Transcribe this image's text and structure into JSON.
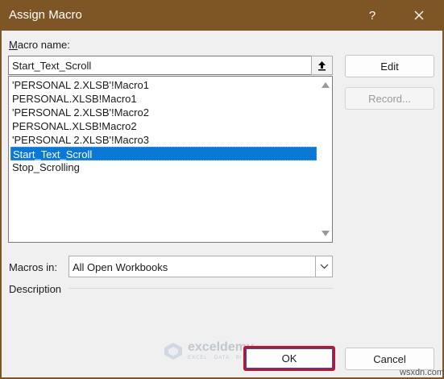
{
  "window": {
    "title": "Assign Macro"
  },
  "titlebar": {
    "help": "?",
    "close_icon": "close-icon"
  },
  "macro_name": {
    "label_accel": "M",
    "label_rest": "acro name:",
    "value": "Start_Text_Scroll"
  },
  "macros": [
    "'PERSONAL 2.XLSB'!Macro1",
    "PERSONAL.XLSB!Macro1",
    "'PERSONAL 2.XLSB'!Macro2",
    "PERSONAL.XLSB!Macro2",
    "'PERSONAL 2.XLSB'!Macro3",
    "Start_Text_Scroll",
    "Stop_Scrolling"
  ],
  "selected_macro": "Start_Text_Scroll",
  "buttons": {
    "edit": "Edit",
    "record": "Record...",
    "ok": "OK",
    "cancel": "Cancel"
  },
  "macros_in": {
    "label": "Macros in:",
    "value": "All Open Workbooks"
  },
  "description": {
    "label": "Description"
  },
  "watermark": {
    "name": "exceldemy",
    "tagline": "EXCEL · DATA · BI"
  },
  "source_mark": "wsxdn.com",
  "colors": {
    "titlebar": "#7e5625",
    "selection": "#0a78d7",
    "ok_highlight": "#c8102e"
  }
}
